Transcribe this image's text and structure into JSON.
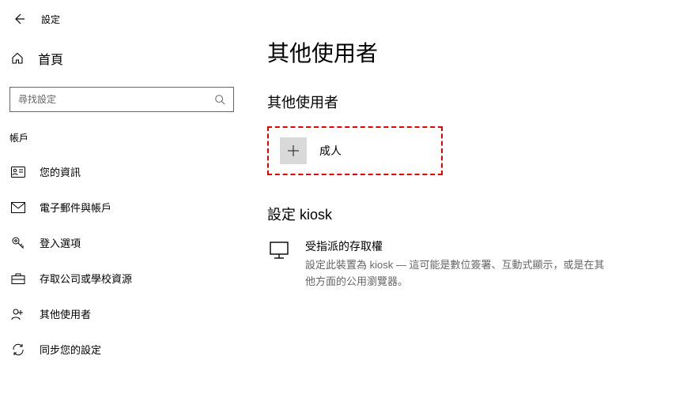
{
  "header": {
    "title": "設定"
  },
  "home": {
    "label": "首頁"
  },
  "search": {
    "placeholder": "尋找設定"
  },
  "sidebar": {
    "section": "帳戶",
    "items": [
      {
        "label": "您的資訊"
      },
      {
        "label": "電子郵件與帳戶"
      },
      {
        "label": "登入選項"
      },
      {
        "label": "存取公司或學校資源"
      },
      {
        "label": "其他使用者"
      },
      {
        "label": "同步您的設定"
      }
    ]
  },
  "main": {
    "title": "其他使用者",
    "otherUsers": {
      "heading": "其他使用者",
      "addLabel": "成人"
    },
    "kiosk": {
      "heading": "設定 kiosk",
      "title": "受指派的存取權",
      "description": "設定此裝置為 kiosk — 這可能是數位簽署、互動式顯示，或是在其他方面的公用瀏覽器。"
    }
  }
}
